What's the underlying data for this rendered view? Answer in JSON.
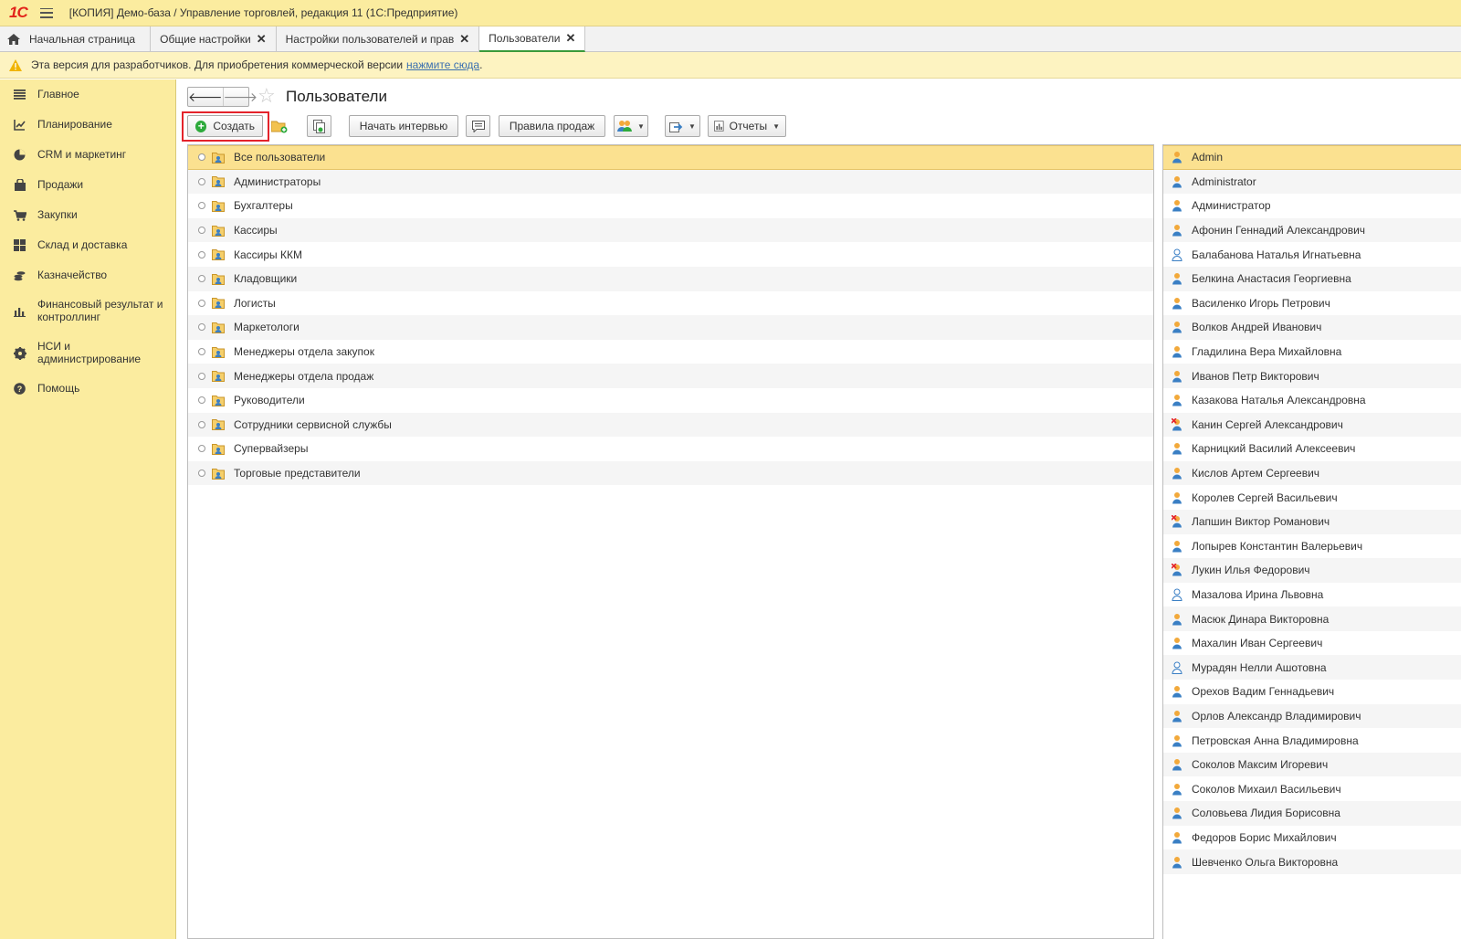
{
  "window": {
    "logo": "1С",
    "title": "[КОПИЯ] Демо-база / Управление торговлей, редакция 11  (1С:Предприятие)"
  },
  "tabs": [
    {
      "label": "Начальная страница",
      "closable": false
    },
    {
      "label": "Общие настройки",
      "closable": true
    },
    {
      "label": "Настройки пользователей и прав",
      "closable": true
    },
    {
      "label": "Пользователи",
      "closable": true,
      "active": true
    }
  ],
  "warning": {
    "text": "Эта версия для разработчиков. Для приобретения коммерческой версии",
    "link": "нажмите сюда",
    "suffix": "."
  },
  "sidebar": {
    "items": [
      {
        "label": "Главное",
        "icon": "menu-lines-icon"
      },
      {
        "label": "Планирование",
        "icon": "planning-icon"
      },
      {
        "label": "CRM и маркетинг",
        "icon": "pie-chart-icon"
      },
      {
        "label": "Продажи",
        "icon": "bag-icon"
      },
      {
        "label": "Закупки",
        "icon": "cart-icon"
      },
      {
        "label": "Склад и доставка",
        "icon": "warehouse-grid-icon"
      },
      {
        "label": "Казначейство",
        "icon": "coins-icon"
      },
      {
        "label": "Финансовый результат и контроллинг",
        "icon": "bar-chart-icon"
      },
      {
        "label": "НСИ и администрирование",
        "icon": "gear-icon"
      },
      {
        "label": "Помощь",
        "icon": "help-icon"
      }
    ]
  },
  "page": {
    "title": "Пользователи"
  },
  "toolbar": {
    "create_label": "Создать",
    "interview_label": "Начать интервью",
    "sales_rules_label": "Правила продаж",
    "reports_label": "Отчеты"
  },
  "groups": [
    "Все пользователи",
    "Администраторы",
    "Бухгалтеры",
    "Кассиры",
    "Кассиры ККМ",
    "Кладовщики",
    "Логисты",
    "Маркетологи",
    "Менеджеры отдела закупок",
    "Менеджеры отдела продаж",
    "Руководители",
    "Сотрудники сервисной службы",
    "Супервайзеры",
    "Торговые представители"
  ],
  "users": [
    {
      "name": "Admin",
      "status": "active"
    },
    {
      "name": "Administrator",
      "status": "active"
    },
    {
      "name": "Администратор",
      "status": "active"
    },
    {
      "name": "Афонин Геннадий Александрович",
      "status": "active"
    },
    {
      "name": "Балабанова Наталья Игнатьевна",
      "status": "no-access"
    },
    {
      "name": "Белкина Анастасия Георгиевна",
      "status": "active"
    },
    {
      "name": "Василенко Игорь Петрович",
      "status": "active"
    },
    {
      "name": "Волков Андрей Иванович",
      "status": "active"
    },
    {
      "name": "Гладилина Вера Михайловна",
      "status": "active"
    },
    {
      "name": "Иванов Петр Викторович",
      "status": "active"
    },
    {
      "name": "Казакова Наталья Александровна",
      "status": "active"
    },
    {
      "name": "Канин Сергей Александрович",
      "status": "marked"
    },
    {
      "name": "Карницкий Василий Алексеевич",
      "status": "active"
    },
    {
      "name": "Кислов Артем Сергеевич",
      "status": "active"
    },
    {
      "name": "Королев Сергей Васильевич",
      "status": "active"
    },
    {
      "name": "Лапшин Виктор Романович",
      "status": "marked"
    },
    {
      "name": "Лопырев Константин Валерьевич",
      "status": "active"
    },
    {
      "name": "Лукин Илья Федорович",
      "status": "marked"
    },
    {
      "name": "Мазалова Ирина Львовна",
      "status": "no-access"
    },
    {
      "name": "Масюк Динара Викторовна",
      "status": "active"
    },
    {
      "name": "Махалин Иван Сергеевич",
      "status": "active"
    },
    {
      "name": "Мурадян Нелли Ашотовна",
      "status": "no-access"
    },
    {
      "name": "Орехов Вадим Геннадьевич",
      "status": "active"
    },
    {
      "name": "Орлов Александр Владимирович",
      "status": "active"
    },
    {
      "name": "Петровская Анна Владимировна",
      "status": "active"
    },
    {
      "name": "Соколов Максим Игоревич",
      "status": "active"
    },
    {
      "name": "Соколов Михаил Васильевич",
      "status": "active"
    },
    {
      "name": "Соловьева Лидия Борисовна",
      "status": "active"
    },
    {
      "name": "Федоров Борис Михайлович",
      "status": "active"
    },
    {
      "name": "Шевченко Ольга Викторовна",
      "status": "active"
    }
  ],
  "colors": {
    "accent_yellow": "#fbec9f",
    "selection": "#fbe190",
    "highlight_red": "#e4232b",
    "create_green": "#2eaa3c"
  }
}
